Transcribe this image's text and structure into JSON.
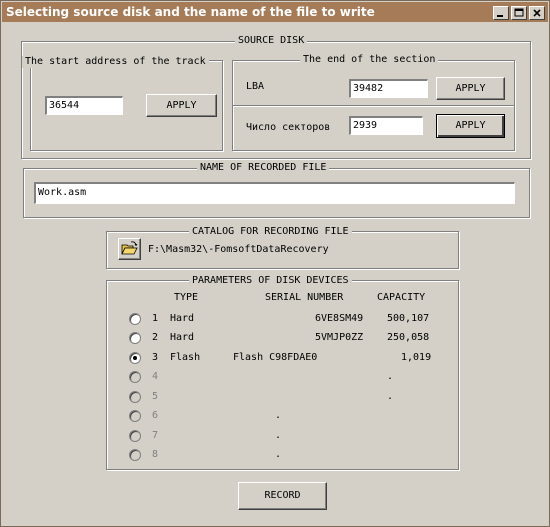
{
  "window": {
    "title": "Selecting source disk and the name of the file to write",
    "controls": [
      "minimize",
      "maximize",
      "close"
    ]
  },
  "source_disk": {
    "legend": "SOURCE DISK",
    "start": {
      "legend": "The start address of the track",
      "value": "36544",
      "apply_label": "APPLY"
    },
    "end": {
      "legend": "The end of the section",
      "lba_label": "LBA",
      "lba_value": "39482",
      "lba_apply_label": "APPLY",
      "sectors_label": "Число секторов",
      "sectors_value": "2939",
      "sectors_apply_label": "APPLY"
    }
  },
  "recorded_file": {
    "legend": "NAME OF RECORDED FILE",
    "value": "Work.asm"
  },
  "catalog": {
    "legend": "CATALOG FOR RECORDING FILE",
    "icon": "open-folder-icon",
    "path": "F:\\Masm32\\-FomsoftDataRecovery"
  },
  "devices": {
    "legend": "PARAMETERS OF DISK DEVICES",
    "headers": {
      "type": "TYPE",
      "serial": "SERIAL NUMBER",
      "capacity": "CAPACITY"
    },
    "rows": [
      {
        "num": "1",
        "type": "Hard",
        "serial": "6VE8SM49",
        "capacity": "500,107",
        "selected": false,
        "enabled": true
      },
      {
        "num": "2",
        "type": "Hard",
        "serial": "5VMJP0ZZ",
        "capacity": "250,058",
        "selected": false,
        "enabled": true
      },
      {
        "num": "3",
        "type": "Flash",
        "serial": "Flash C98FDAE0",
        "capacity": "1,019",
        "selected": true,
        "enabled": true
      },
      {
        "num": "4",
        "type": "",
        "serial": "",
        "capacity": ".",
        "selected": false,
        "enabled": false
      },
      {
        "num": "5",
        "type": "",
        "serial": "",
        "capacity": ".",
        "selected": false,
        "enabled": false
      },
      {
        "num": "6",
        "type": "",
        "serial": ".",
        "capacity": "",
        "selected": false,
        "enabled": false
      },
      {
        "num": "7",
        "type": "",
        "serial": ".",
        "capacity": "",
        "selected": false,
        "enabled": false
      },
      {
        "num": "8",
        "type": "",
        "serial": ".",
        "capacity": "",
        "selected": false,
        "enabled": false
      }
    ]
  },
  "record_label": "RECORD"
}
